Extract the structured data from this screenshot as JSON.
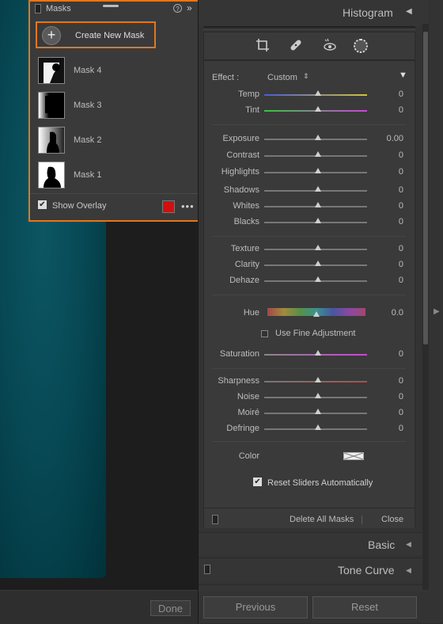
{
  "mask_panel": {
    "title": "Masks",
    "help_icon": "?",
    "expand_icon": "»",
    "create_label": "Create New Mask",
    "masks": [
      {
        "label": "Mask 4"
      },
      {
        "label": "Mask 3"
      },
      {
        "label": "Mask 2"
      },
      {
        "label": "Mask 1"
      }
    ],
    "show_overlay_label": "Show Overlay",
    "overlay_color": "#d10f0f",
    "more_icon": "•••"
  },
  "canvas": {
    "done_label": "Done"
  },
  "histogram": {
    "title": "Histogram",
    "arrow": "◀"
  },
  "effect": {
    "label": "Effect :",
    "value": "Custom",
    "caret": "⇕",
    "collapse": "▼"
  },
  "sliders": {
    "temp": {
      "label": "Temp",
      "value": "0"
    },
    "tint": {
      "label": "Tint",
      "value": "0"
    },
    "exposure": {
      "label": "Exposure",
      "value": "0.00"
    },
    "contrast": {
      "label": "Contrast",
      "value": "0"
    },
    "highlights": {
      "label": "Highlights",
      "value": "0"
    },
    "shadows": {
      "label": "Shadows",
      "value": "0"
    },
    "whites": {
      "label": "Whites",
      "value": "0"
    },
    "blacks": {
      "label": "Blacks",
      "value": "0"
    },
    "texture": {
      "label": "Texture",
      "value": "0"
    },
    "clarity": {
      "label": "Clarity",
      "value": "0"
    },
    "dehaze": {
      "label": "Dehaze",
      "value": "0"
    },
    "hue": {
      "label": "Hue",
      "value": "0.0"
    },
    "saturation": {
      "label": "Saturation",
      "value": "0"
    },
    "sharpness": {
      "label": "Sharpness",
      "value": "0"
    },
    "noise": {
      "label": "Noise",
      "value": "0"
    },
    "moire": {
      "label": "Moiré",
      "value": "0"
    },
    "defringe": {
      "label": "Defringe",
      "value": "0"
    }
  },
  "fine_adjustment_label": "Use Fine Adjustment",
  "color_label": "Color",
  "reset_sliders_label": "Reset Sliders Automatically",
  "footer": {
    "delete_all_label": "Delete All Masks",
    "separator": "|",
    "close_label": "Close"
  },
  "panels": {
    "basic_label": "Basic",
    "tone_curve_label": "Tone Curve",
    "collapse_arrow": "◀"
  },
  "nav": {
    "previous_label": "Previous",
    "reset_label": "Reset"
  },
  "colors": {
    "accent_highlight": "#e0771f",
    "overlay_red": "#d10f0f"
  }
}
